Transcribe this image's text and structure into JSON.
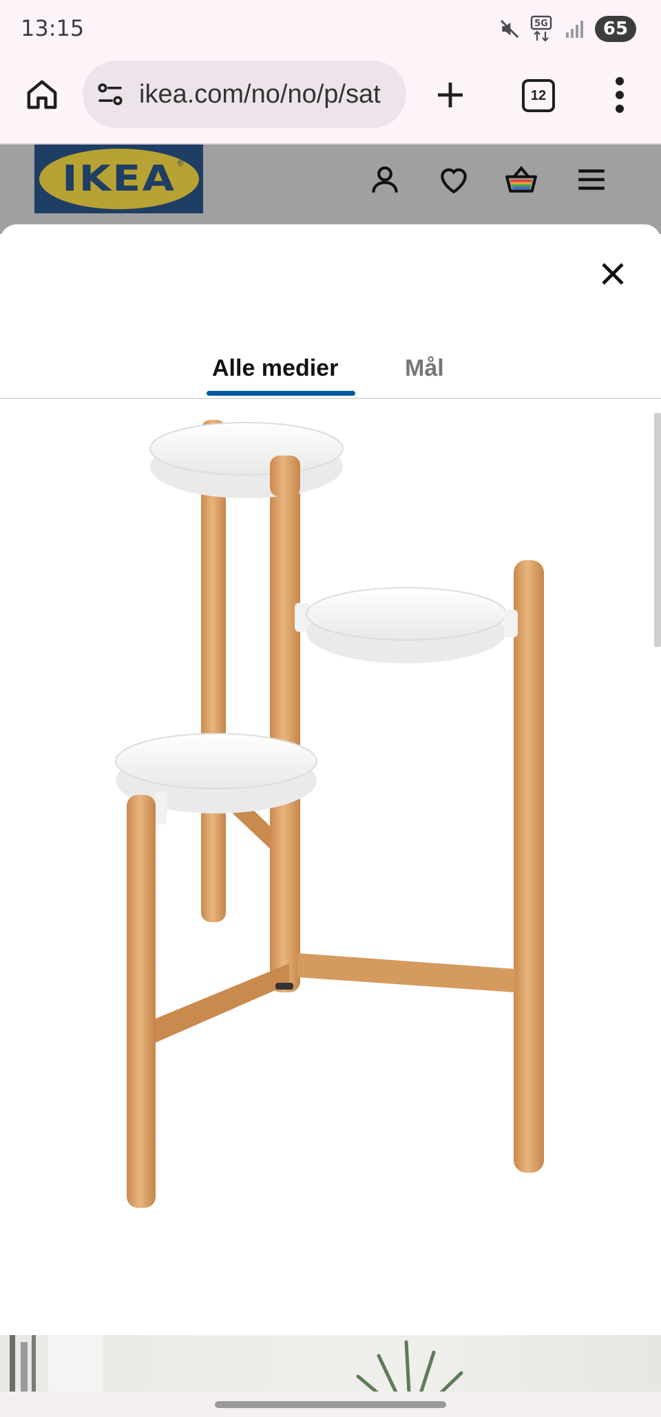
{
  "status_bar": {
    "time": "13:15",
    "network": "5G",
    "battery": "65",
    "icons": [
      "mute-icon",
      "5g-data-icon",
      "signal-icon",
      "battery-icon"
    ]
  },
  "browser": {
    "url": "ikea.com/no/no/p/sat",
    "tab_count": "12",
    "icons": [
      "home-icon",
      "site-settings-icon",
      "new-tab-icon",
      "tabs-icon",
      "more-icon"
    ]
  },
  "site_header": {
    "logo_text": "IKEA",
    "logo_reg": "®",
    "icons": [
      "account-icon",
      "wishlist-heart-icon",
      "shopping-bag-icon",
      "menu-icon"
    ]
  },
  "modal": {
    "tabs": [
      {
        "label": "Alle medier",
        "selected": true
      },
      {
        "label": "Mål",
        "selected": false
      }
    ],
    "close_icon": "close-icon"
  },
  "colors": {
    "ikea_blue": "#0058a3",
    "logo_background": "#1e3e64",
    "logo_yellow": "#b7a233",
    "bamboo": "#d9a066",
    "tray_white": "#f4f4f2"
  }
}
